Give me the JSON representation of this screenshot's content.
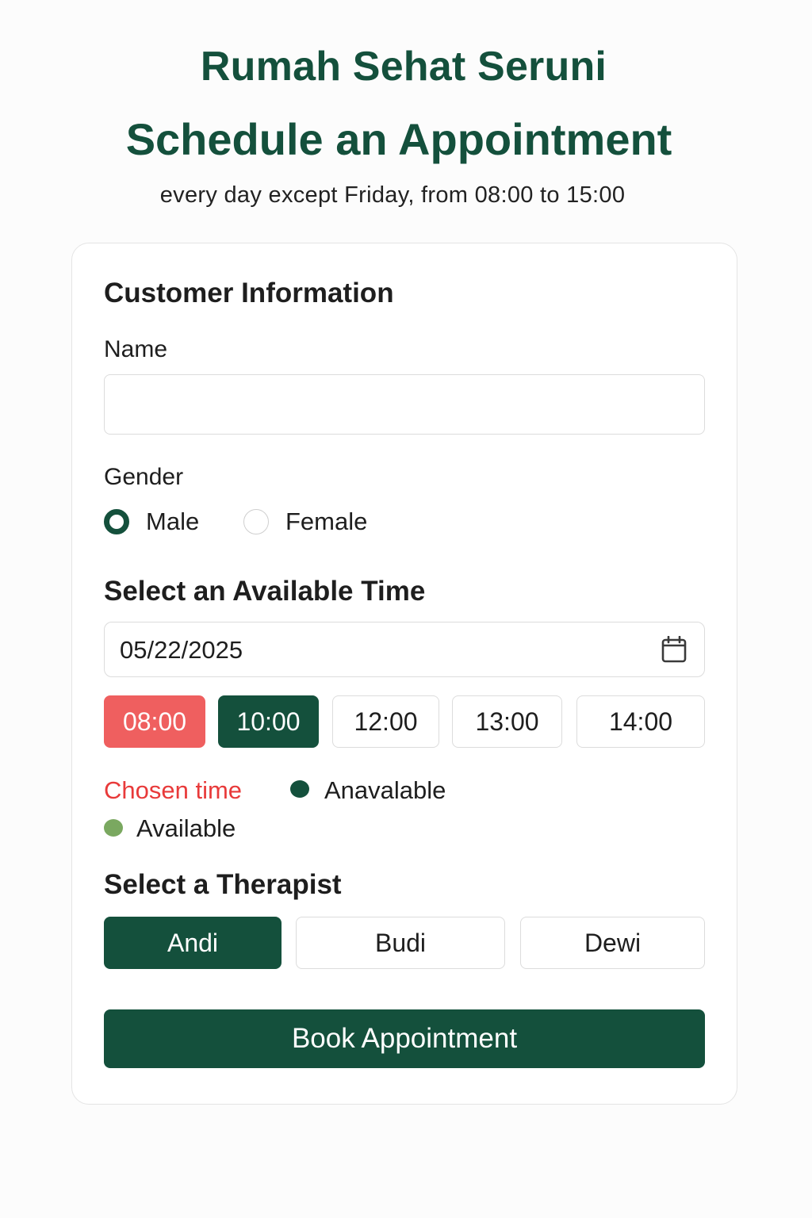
{
  "header": {
    "brand": "Rumah Sehat Seruni",
    "title": "Schedule an Appointment",
    "hours": "every day except Friday, from 08:00 to 15:00"
  },
  "customer": {
    "section_title": "Customer Information",
    "name_label": "Name",
    "name_value": "",
    "gender_label": "Gender",
    "gender_options": [
      {
        "label": "Male",
        "checked": true
      },
      {
        "label": "Female",
        "checked": false
      }
    ]
  },
  "time": {
    "section_title": "Select an Available Time",
    "date_value": "05/22/2025",
    "calendar_icon": "calendar-icon",
    "slots": [
      {
        "label": "08:00",
        "status": "chosen"
      },
      {
        "label": "10:00",
        "status": "unavailable"
      },
      {
        "label": "12:00",
        "status": "available"
      },
      {
        "label": "13:00",
        "status": "available"
      },
      {
        "label": "14:00",
        "status": "available"
      }
    ],
    "legend": {
      "chosen": "Chosen time",
      "unavailable": "Anavalable",
      "available": "Available"
    }
  },
  "therapist": {
    "section_title": "Select a Therapist",
    "options": [
      {
        "label": "Andi",
        "selected": true
      },
      {
        "label": "Budi",
        "selected": false
      },
      {
        "label": "Dewi",
        "selected": false
      }
    ]
  },
  "actions": {
    "book_label": "Book Appointment"
  },
  "colors": {
    "primary": "#14503c",
    "chosen": "#ef5f5f",
    "chosen_text": "#e83a3a",
    "available": "#7aa860",
    "border": "#dcdcdc"
  }
}
